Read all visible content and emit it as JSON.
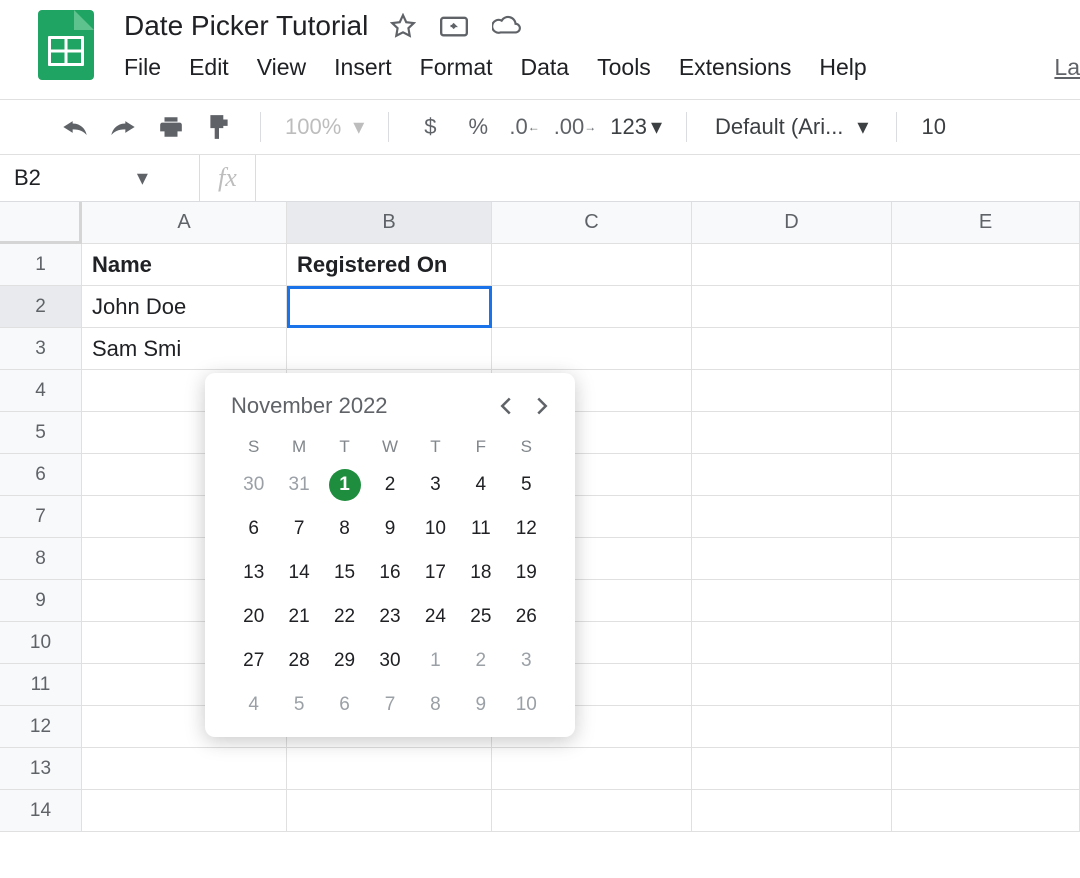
{
  "doc": {
    "title": "Date Picker Tutorial"
  },
  "menu": {
    "file": "File",
    "edit": "Edit",
    "view": "View",
    "insert": "Insert",
    "format": "Format",
    "data": "Data",
    "tools": "Tools",
    "extensions": "Extensions",
    "help": "Help",
    "la": "La"
  },
  "toolbar": {
    "zoom": "100%",
    "currency": "$",
    "percent": "%",
    "dec_less": ".0",
    "dec_more": ".00",
    "numfmt": "123",
    "font": "Default (Ari...",
    "font_size": "10"
  },
  "namebox": {
    "value": "B2"
  },
  "fx_label": "fx",
  "columns": [
    "A",
    "B",
    "C",
    "D",
    "E"
  ],
  "rows": [
    "1",
    "2",
    "3",
    "4",
    "5",
    "6",
    "7",
    "8",
    "9",
    "10",
    "11",
    "12",
    "13",
    "14"
  ],
  "cells": {
    "A1": "Name",
    "B1": "Registered On",
    "A2": "John Doe",
    "A3": "Sam Smi"
  },
  "active_cell": "B2",
  "datepicker": {
    "label": "November 2022",
    "dow": [
      "S",
      "M",
      "T",
      "W",
      "T",
      "F",
      "S"
    ],
    "weeks": [
      [
        {
          "n": "30",
          "muted": true
        },
        {
          "n": "31",
          "muted": true
        },
        {
          "n": "1",
          "today": true
        },
        {
          "n": "2"
        },
        {
          "n": "3"
        },
        {
          "n": "4"
        },
        {
          "n": "5"
        }
      ],
      [
        {
          "n": "6"
        },
        {
          "n": "7"
        },
        {
          "n": "8"
        },
        {
          "n": "9"
        },
        {
          "n": "10"
        },
        {
          "n": "11"
        },
        {
          "n": "12"
        }
      ],
      [
        {
          "n": "13"
        },
        {
          "n": "14"
        },
        {
          "n": "15"
        },
        {
          "n": "16"
        },
        {
          "n": "17"
        },
        {
          "n": "18"
        },
        {
          "n": "19"
        }
      ],
      [
        {
          "n": "20"
        },
        {
          "n": "21"
        },
        {
          "n": "22"
        },
        {
          "n": "23"
        },
        {
          "n": "24"
        },
        {
          "n": "25"
        },
        {
          "n": "26"
        }
      ],
      [
        {
          "n": "27"
        },
        {
          "n": "28"
        },
        {
          "n": "29"
        },
        {
          "n": "30"
        },
        {
          "n": "1",
          "muted": true
        },
        {
          "n": "2",
          "muted": true
        },
        {
          "n": "3",
          "muted": true
        }
      ],
      [
        {
          "n": "4",
          "muted": true
        },
        {
          "n": "5",
          "muted": true
        },
        {
          "n": "6",
          "muted": true
        },
        {
          "n": "7",
          "muted": true
        },
        {
          "n": "8",
          "muted": true
        },
        {
          "n": "9",
          "muted": true
        },
        {
          "n": "10",
          "muted": true
        }
      ]
    ]
  }
}
